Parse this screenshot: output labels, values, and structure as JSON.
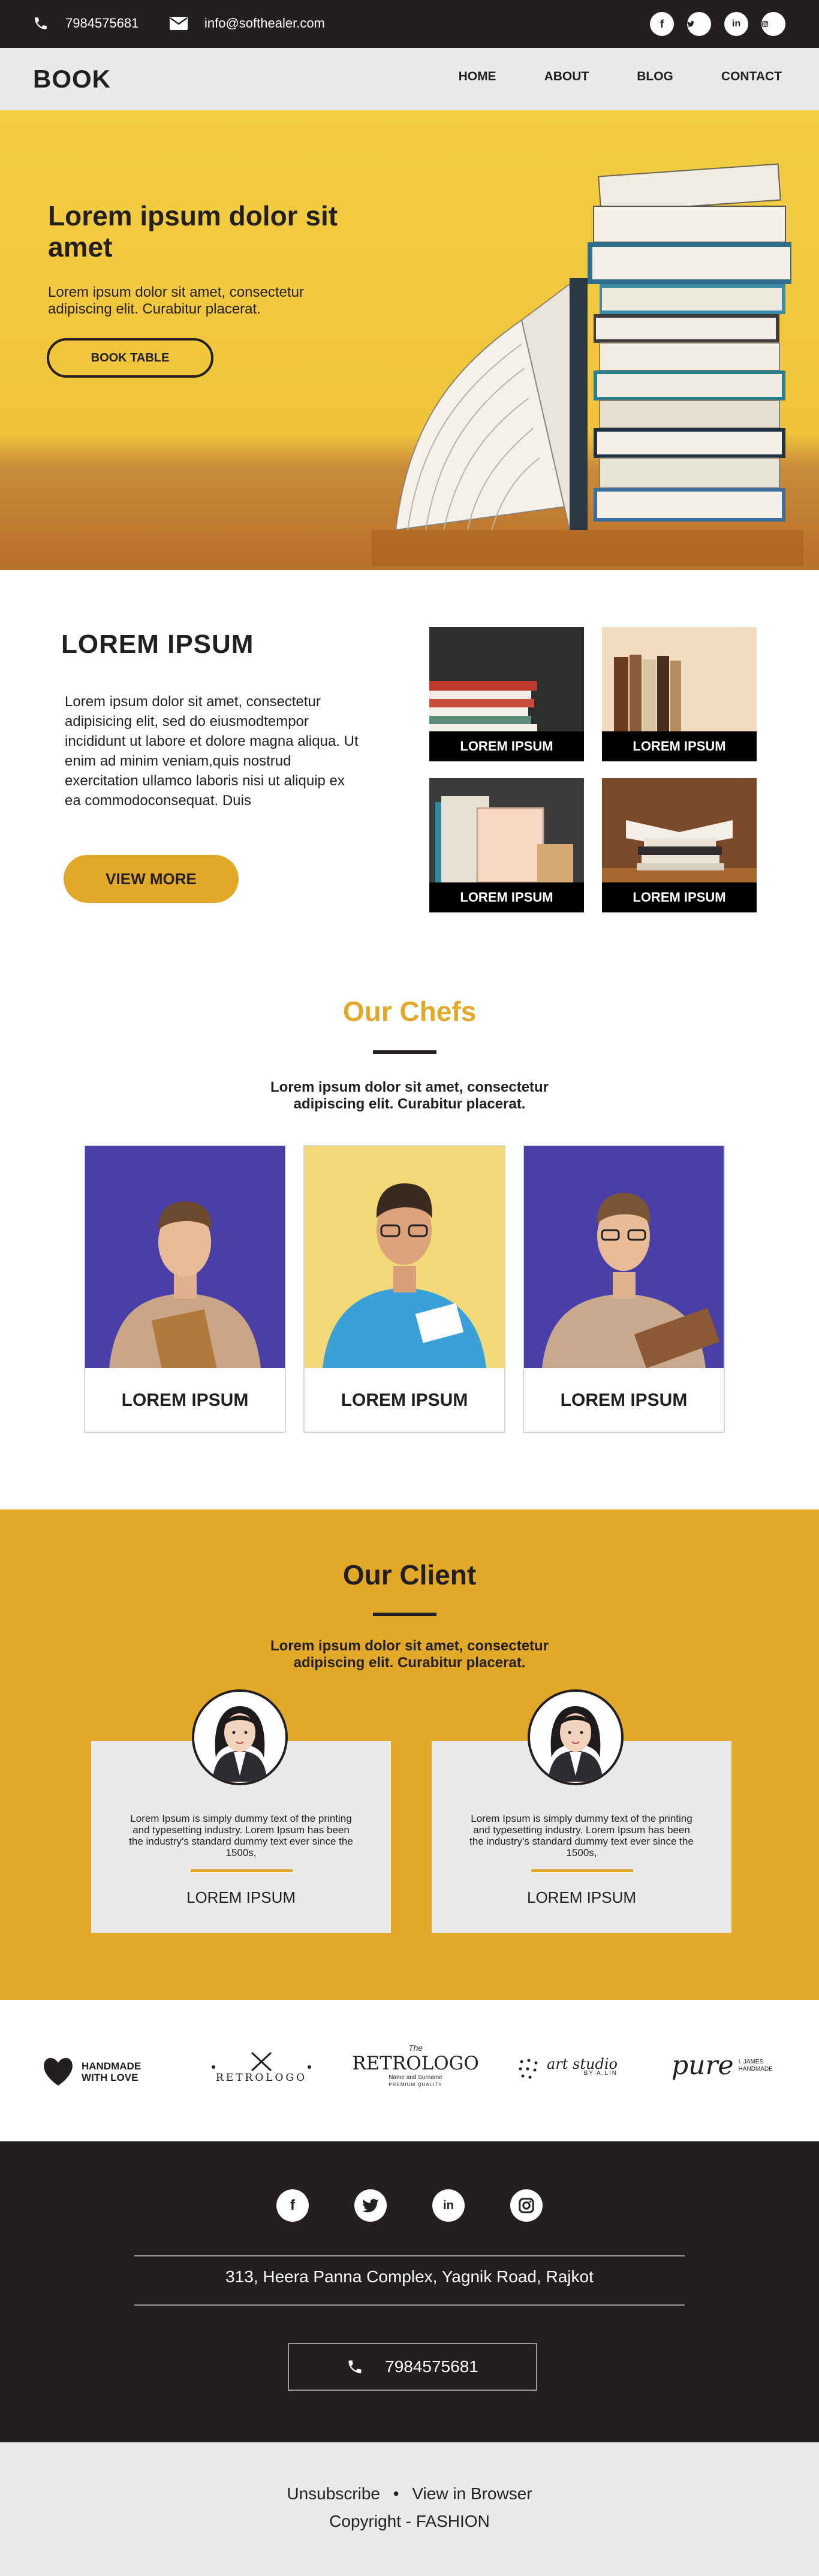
{
  "topbar": {
    "phone": "7984575681",
    "email": "info@softhealer.com",
    "socials": [
      "facebook-icon",
      "twitter-icon",
      "linkedin-icon",
      "instagram-icon"
    ]
  },
  "nav": {
    "brand": "BOOK",
    "items": [
      "HOME",
      "ABOUT",
      "BLOG",
      "CONTACT"
    ]
  },
  "hero": {
    "title": "Lorem ipsum dolor sit amet",
    "text": "Lorem ipsum dolor sit amet, consectetur adipiscing elit. Curabitur placerat.",
    "button": "BOOK TABLE"
  },
  "about": {
    "title": "LOREM IPSUM",
    "text": "Lorem ipsum dolor sit amet, consectetur adipisicing elit, sed do eiusmodtempor incididunt ut labore et dolore magna aliqua. Ut enim ad minim veniam,quis nostrud exercitation ullamco laboris nisi ut aliquip ex ea commodoconsequat. Duis",
    "button": "VIEW MORE",
    "tiles": [
      "LOREM IPSUM",
      "LOREM IPSUM",
      "LOREM IPSUM",
      "LOREM IPSUM"
    ]
  },
  "chefs": {
    "title": "Our Chefs",
    "subtitle": "Lorem ipsum dolor sit amet, consectetur adipiscing elit. Curabitur placerat.",
    "items": [
      "LOREM IPSUM",
      "LOREM IPSUM",
      "LOREM IPSUM"
    ]
  },
  "clients": {
    "title": "Our Client",
    "subtitle": "Lorem ipsum dolor sit amet, consectetur adipiscing elit. Curabitur placerat.",
    "items": [
      {
        "text": "Lorem Ipsum is simply dummy text of the printing and typesetting industry. Lorem Ipsum has been the industry's standard dummy text ever since the 1500s,",
        "name": "LOREM IPSUM"
      },
      {
        "text": "Lorem Ipsum is simply dummy text of the printing and typesetting industry. Lorem Ipsum has been the industry's standard dummy text ever since the 1500s,",
        "name": "LOREM IPSUM"
      }
    ]
  },
  "logos": {
    "handmade": "HANDMADE WITH LOVE",
    "retrologo1": "RETROLOGO",
    "retrologo2": "RETROLOGO",
    "retrologo2_the": "The",
    "retrologo2_sub": "Name and Surname",
    "retrologo2_tag": "PREMIUM QUALITY",
    "art": "art studio",
    "art_sub": "BY A.LIN",
    "pure": "pure",
    "pure_sub": "I. JAMES HANDMADE"
  },
  "footer": {
    "address": "313, Heera Panna Complex, Yagnik Road, Rajkot",
    "phone": "7984575681",
    "unsubscribe": "Unsubscribe",
    "view": "View in Browser",
    "copyright": "Copyright - FASHION"
  },
  "colors": {
    "dark": "#231f20",
    "accent": "#e2a828",
    "light": "#e9e9e9",
    "hero": "#f3cd42"
  }
}
